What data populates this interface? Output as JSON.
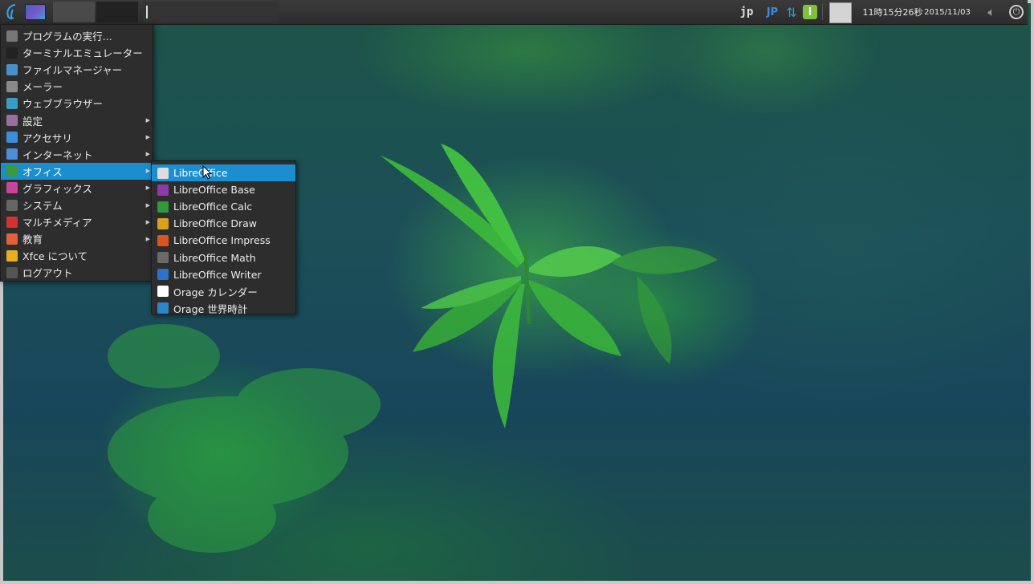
{
  "panel": {
    "kbd_layout_short": "jp",
    "kbd_layout_code": "JP",
    "clock_time": "11時15分26秒",
    "clock_date": "2015/11/03"
  },
  "main_menu": {
    "items": [
      {
        "label": "プログラムの実行...",
        "icon": "run-program-icon",
        "color": "#777777",
        "submenu": false
      },
      {
        "label": "ターミナルエミュレーター",
        "icon": "terminal-icon",
        "color": "#222222",
        "submenu": false
      },
      {
        "label": "ファイルマネージャー",
        "icon": "folder-icon",
        "color": "#4a90c8",
        "submenu": false
      },
      {
        "label": "メーラー",
        "icon": "mail-icon",
        "color": "#8a8a8a",
        "submenu": false
      },
      {
        "label": "ウェブブラウザー",
        "icon": "browser-icon",
        "color": "#3a9bc5",
        "submenu": false
      },
      {
        "label": "設定",
        "icon": "settings-icon",
        "color": "#9a6fa0",
        "submenu": true
      },
      {
        "label": "アクセサリ",
        "icon": "accessories-icon",
        "color": "#3a8fd8",
        "submenu": true
      },
      {
        "label": "インターネット",
        "icon": "internet-icon",
        "color": "#4a8ed8",
        "submenu": true
      },
      {
        "label": "オフィス",
        "icon": "office-icon",
        "color": "#3b9a3b",
        "submenu": true,
        "active": true
      },
      {
        "label": "グラフィックス",
        "icon": "graphics-icon",
        "color": "#c8439a",
        "submenu": true
      },
      {
        "label": "システム",
        "icon": "system-icon",
        "color": "#666666",
        "submenu": true
      },
      {
        "label": "マルチメディア",
        "icon": "multimedia-icon",
        "color": "#d63030",
        "submenu": true
      },
      {
        "label": "教育",
        "icon": "education-icon",
        "color": "#e0623a",
        "submenu": true
      },
      {
        "label": "Xfce について",
        "icon": "star-icon",
        "color": "#e8b020",
        "submenu": false
      },
      {
        "label": "ログアウト",
        "icon": "logout-icon",
        "color": "#555555",
        "submenu": false
      }
    ]
  },
  "office_menu": {
    "items": [
      {
        "label": "LibreOffice",
        "icon": "libreoffice-icon",
        "color": "#dddddd",
        "active": true
      },
      {
        "label": "LibreOffice Base",
        "icon": "libreoffice-base-icon",
        "color": "#8e3aa8"
      },
      {
        "label": "LibreOffice Calc",
        "icon": "libreoffice-calc-icon",
        "color": "#2e9a3a"
      },
      {
        "label": "LibreOffice Draw",
        "icon": "libreoffice-draw-icon",
        "color": "#d8a21e"
      },
      {
        "label": "LibreOffice Impress",
        "icon": "libreoffice-impress-icon",
        "color": "#d8561e"
      },
      {
        "label": "LibreOffice Math",
        "icon": "libreoffice-math-icon",
        "color": "#6a6a6a"
      },
      {
        "label": "LibreOffice Writer",
        "icon": "libreoffice-writer-icon",
        "color": "#2a74c8"
      },
      {
        "label": "Orage カレンダー",
        "icon": "calendar-icon",
        "color": "#ffffff"
      },
      {
        "label": "Orage 世界時計",
        "icon": "world-clock-icon",
        "color": "#2a86c8"
      }
    ]
  }
}
